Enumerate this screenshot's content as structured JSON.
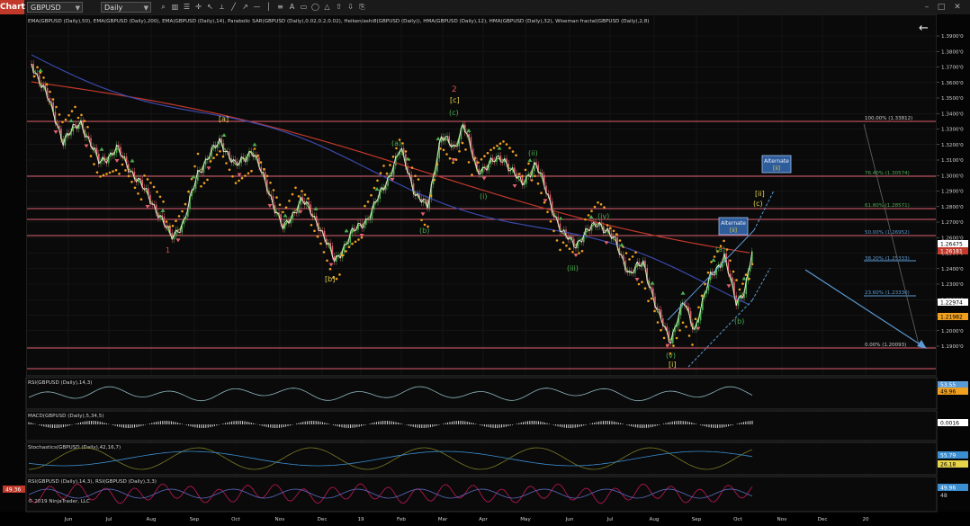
{
  "toolbar": {
    "chart_label": "Chart",
    "instrument": "GBPUSD",
    "timeframe": "Daily"
  },
  "main_panel": {
    "indicators_label": "EMA(GBPUSD (Daily),50), EMA(GBPUSD (Daily),200), EMA(GBPUSD (Daily),14), Parabolic SAR(GBPUSD (Daily),0.02,0.2,0.02), Heiken/ashi8(GBPUSD (Daily)), HMA(GBPUSD (Daily),12), HMA(GBPUSD (Daily),32), Wiseman fractal(GBPUSD (Daily),2,8)",
    "price_axis": [
      "1.3900'0",
      "1.3800'0",
      "1.3700'0",
      "1.3600'0",
      "1.3500'0",
      "1.3400'0",
      "1.3300'0",
      "1.3200'0",
      "1.3100'0",
      "1.3000'0",
      "1.2900'0",
      "1.2800'0",
      "1.2700'0",
      "1.2600'0",
      "1.2500'0",
      "1.2400'0",
      "1.2300'0",
      "1.2200'0",
      "1.2100'0",
      "1.2000'0",
      "1.1900'0"
    ],
    "price_tags": [
      {
        "text": "1.26475",
        "bg": "#ffffff",
        "fg": "#000000"
      },
      {
        "text": "1.26181",
        "bg": "#c0392b",
        "fg": "#ffffff"
      },
      {
        "text": "1.22974",
        "bg": "#ffffff",
        "fg": "#000000"
      },
      {
        "text": "1.21982",
        "bg": "#f0a020",
        "fg": "#000000"
      }
    ],
    "fib_levels": [
      {
        "label": "100.00% (1.33812)",
        "color": "#cccccc"
      },
      {
        "label": "76.40% (1.30574)",
        "color": "#4caf50"
      },
      {
        "label": "61.80% (1.28571)",
        "color": "#4caf50"
      },
      {
        "label": "50.00% (1.26952)",
        "color": "#5b9bd5"
      },
      {
        "label": "38.20% (1.25333)",
        "color": "#5b9bd5"
      },
      {
        "label": "23.60% (1.23330)",
        "color": "#5b9bd5"
      },
      {
        "label": "0.00% (1.20093)",
        "color": "#cccccc"
      }
    ],
    "wave_labels": [
      {
        "text": "1",
        "color": "#e05050"
      },
      {
        "text": "[a]",
        "color": "#e6d44a"
      },
      {
        "text": "[b]",
        "color": "#e6d44a"
      },
      {
        "text": "2",
        "color": "#e05050"
      },
      {
        "text": "[c]",
        "color": "#e6d44a"
      },
      {
        "text": "(c)",
        "color": "#4caf50"
      },
      {
        "text": "(a)",
        "color": "#4caf50"
      },
      {
        "text": "(b)",
        "color": "#4caf50"
      },
      {
        "text": "(i)",
        "color": "#4caf50"
      },
      {
        "text": "(ii)",
        "color": "#4caf50"
      },
      {
        "text": "(iii)",
        "color": "#4caf50"
      },
      {
        "text": "(iv)",
        "color": "#4caf50"
      },
      {
        "text": "(v)",
        "color": "#4caf50"
      },
      {
        "text": "[i]",
        "color": "#e6d44a"
      },
      {
        "text": "(a)",
        "color": "#4caf50"
      },
      {
        "text": "(b)",
        "color": "#4caf50"
      },
      {
        "text": "(c)",
        "color": "#e6d44a"
      },
      {
        "text": "[ii]",
        "color": "#e6d44a"
      }
    ],
    "alternate_boxes": [
      {
        "line1": "Alternate",
        "line2": "[ii]"
      },
      {
        "line1": "Alternate",
        "line2": "[ii]"
      }
    ]
  },
  "rsi_panel": {
    "label": "RSI(GBPUSD (Daily),14,3)",
    "value": "49.96",
    "value2": "53.55"
  },
  "macd_panel": {
    "label": "MACD(GBPUSD (Daily),5,34,5)",
    "value": "0.0016"
  },
  "stoch_panel": {
    "label": "Stochastics(GBPUSD (Daily),42,16,7)",
    "value1": "55.79",
    "value2": "26.18"
  },
  "rsi2_panel": {
    "label": "RSI(GBPUSD (Daily),14,3), RSI(GBPUSD (Daily),3,3)",
    "value": "49.96",
    "left_value": "49.36",
    "mid_label": "48"
  },
  "copyright": "© 2019 NinjaTrader, LLC",
  "time_axis": [
    "Jun",
    "Jul",
    "Aug",
    "Sep",
    "Oct",
    "Nov",
    "Dec",
    "19",
    "Feb",
    "Mar",
    "Apr",
    "May",
    "Jun",
    "Jul",
    "Aug",
    "Sep",
    "Oct",
    "Nov",
    "Dec",
    "20"
  ]
}
